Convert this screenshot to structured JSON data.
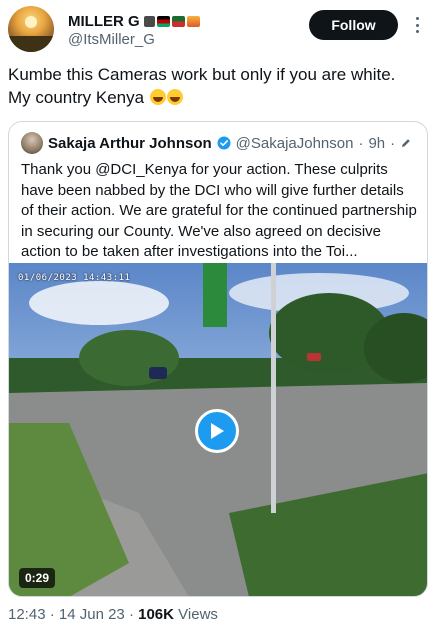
{
  "author": {
    "display_name": "MILLER G",
    "handle": "@ItsMiller_G",
    "emoji_badges": [
      "camera-icon",
      "flag-icon",
      "flag-icon",
      "sunset-icon"
    ]
  },
  "follow_button": {
    "label": "Follow"
  },
  "tweet": {
    "text_line1": "Kumbe this Cameras work but only if you are white.",
    "text_line2": "My country Kenya",
    "emojis": [
      "laughing-face-icon",
      "laughing-face-icon"
    ]
  },
  "quoted_tweet": {
    "author_name": "Sakaja Arthur Johnson",
    "handle": "@SakajaJohnson",
    "separator": "·",
    "time": "9h",
    "text": "Thank you @DCI_Kenya for your action. These culprits have been nabbed by the DCI who will give further details of their action. We are grateful for the continued partnership in securing our County. We've also agreed on decisive action to be taken after investigations into the Toi...",
    "video": {
      "timestamp": "01/06/2023 14:43:11",
      "duration": "0:29"
    }
  },
  "meta": {
    "time": "12:43",
    "separator": "·",
    "date": "14 Jun 23",
    "views_count": "106K",
    "views_label": "Views"
  },
  "colors": {
    "accent": "#1d9bf0",
    "text_primary": "#0f1419",
    "text_secondary": "#536471",
    "border": "#cfd9de"
  }
}
